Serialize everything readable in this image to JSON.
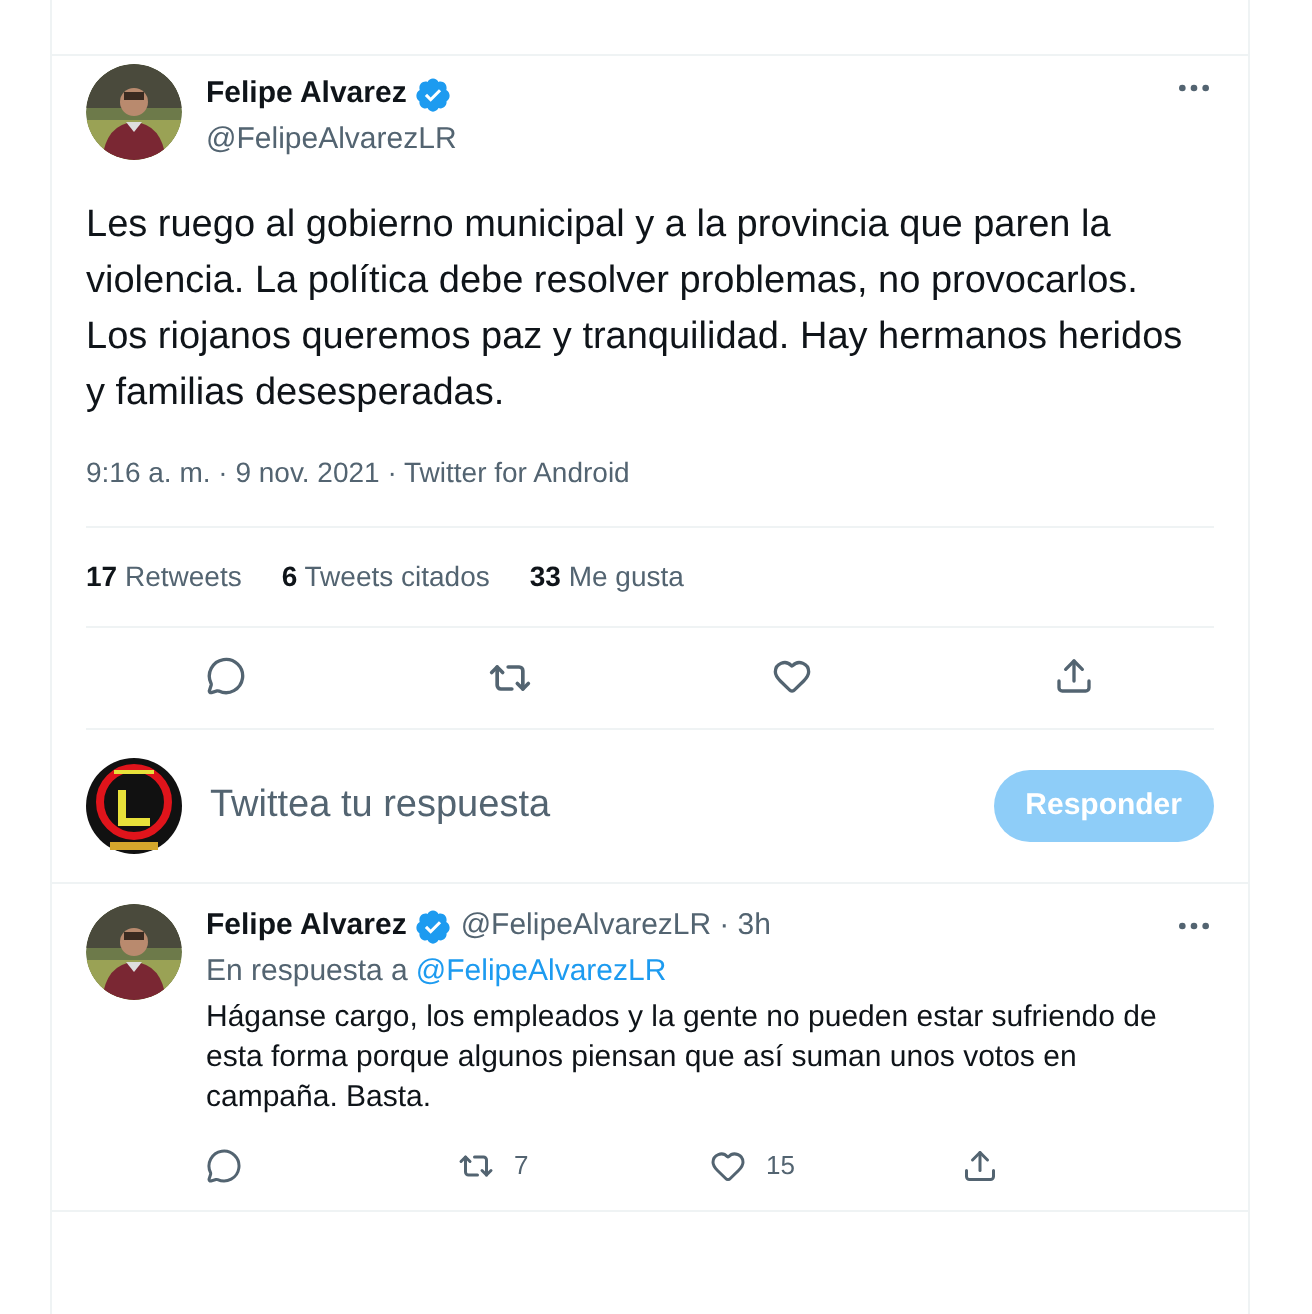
{
  "tweet": {
    "name": "Felipe Alvarez",
    "verified": true,
    "handle": "@FelipeAlvarezLR",
    "text": "Les ruego al gobierno municipal y a la provincia que paren la violencia. La política debe resolver problemas, no provocarlos. Los riojanos queremos paz y tranquilidad. Hay hermanos heridos y familias desesperadas.",
    "meta": "9:16 a. m. · 9 nov. 2021 · Twitter for Android",
    "stats": [
      {
        "count": "17",
        "label": "Retweets"
      },
      {
        "count": "6",
        "label": "Tweets citados"
      },
      {
        "count": "33",
        "label": "Me gusta"
      }
    ]
  },
  "compose": {
    "placeholder": "Twittea tu respuesta",
    "button": "Responder",
    "disabled": true
  },
  "reply": {
    "name": "Felipe Alvarez",
    "verified": true,
    "handle": "@FelipeAlvarezLR",
    "time": "· 3h",
    "replying_to": "En respuesta a",
    "mention": "@FelipeAlvarezLR",
    "text": "Háganse cargo, los empleados y la gente no pueden estar sufriendo de esta forma porque algunos piensan que así suman unos votos en campaña. Basta.",
    "actions": [
      {
        "kind": "reply"
      },
      {
        "kind": "retweet",
        "count": "7"
      },
      {
        "kind": "like",
        "count": "15"
      },
      {
        "kind": "share"
      }
    ]
  }
}
